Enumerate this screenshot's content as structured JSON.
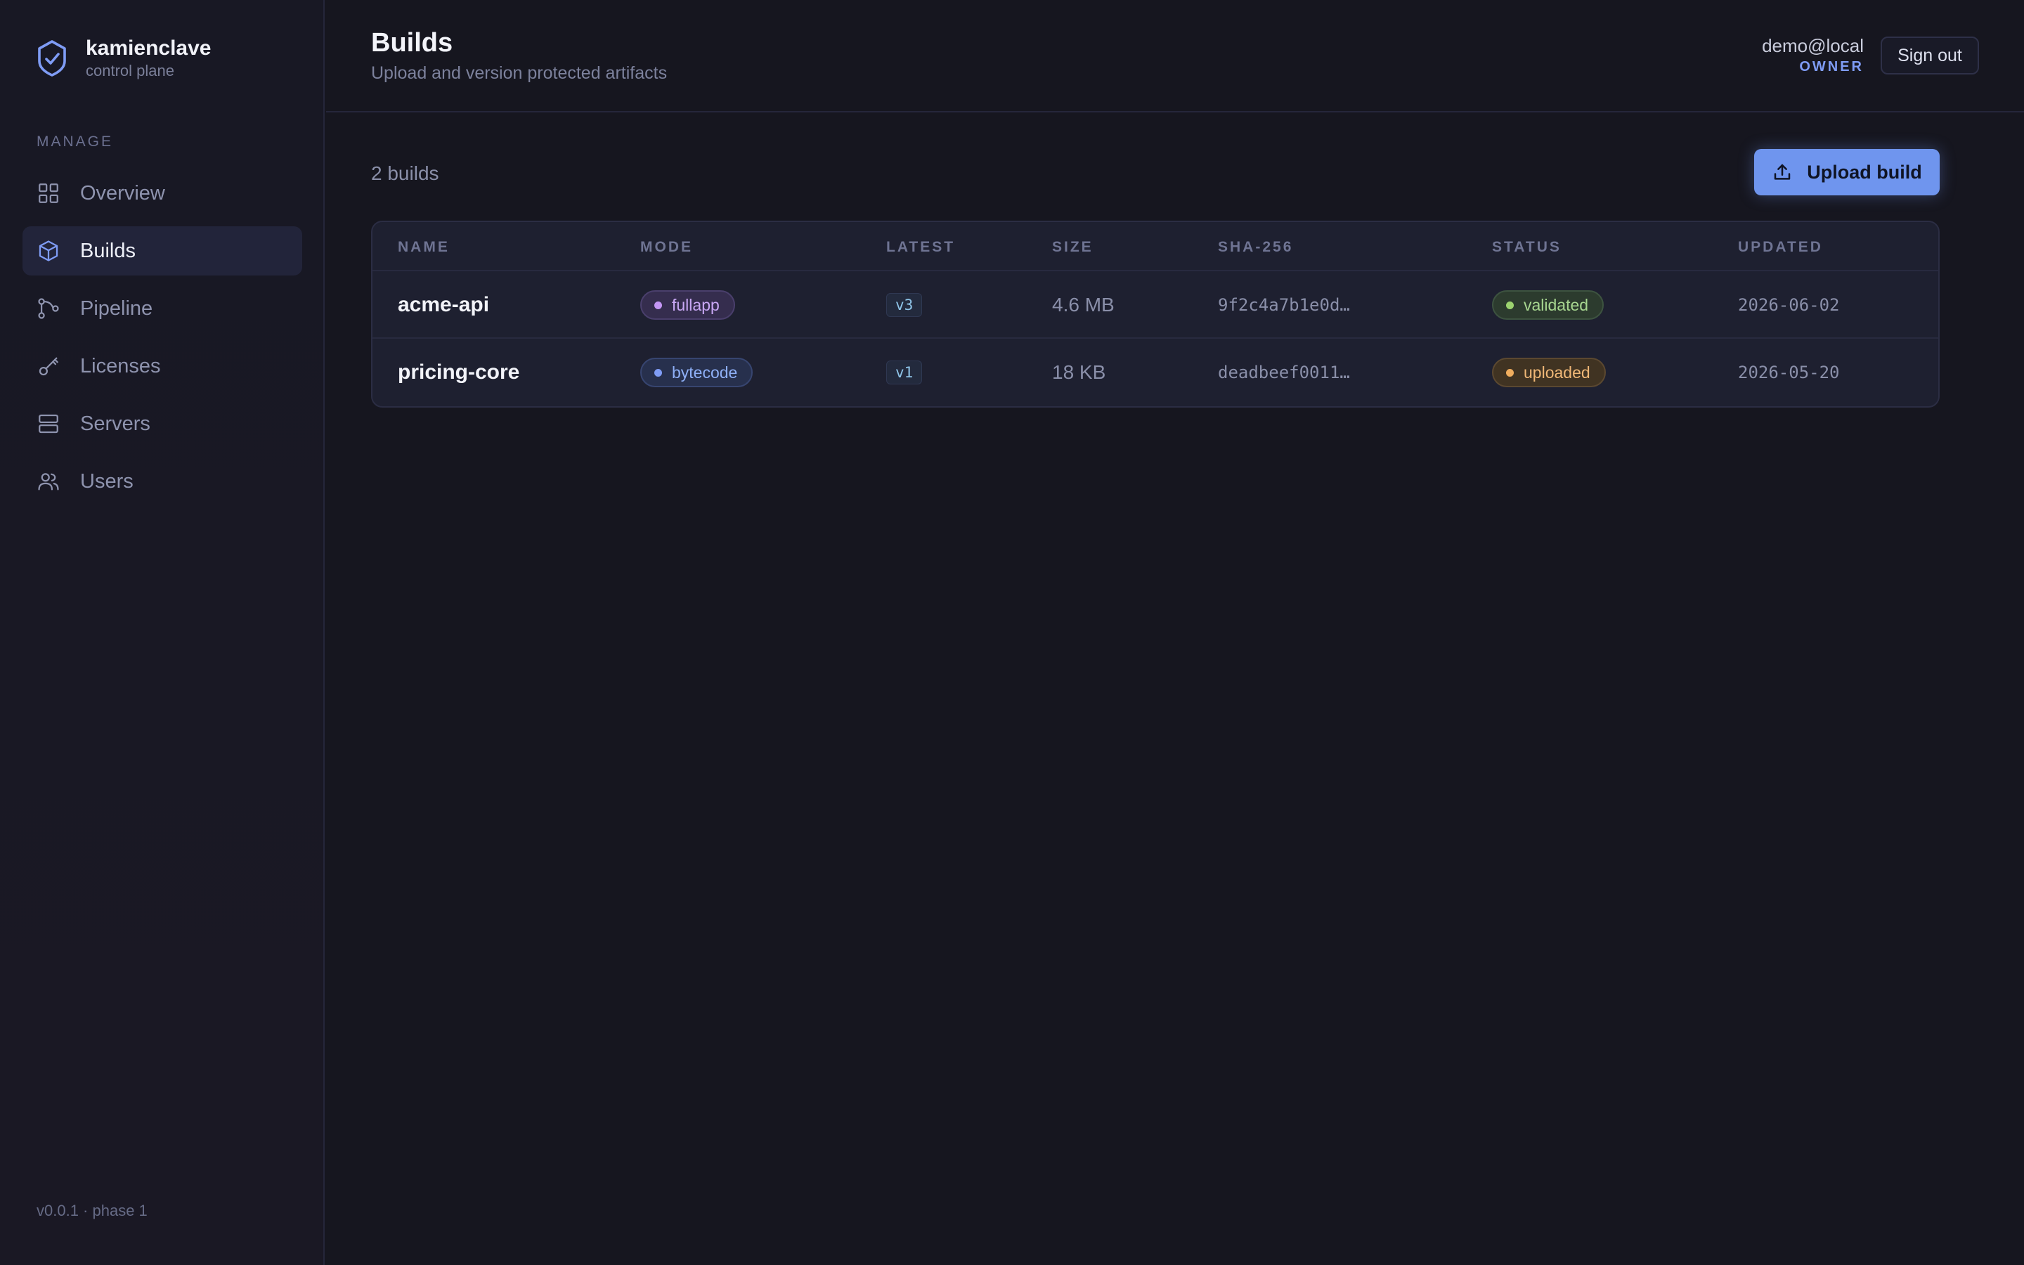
{
  "brand": {
    "name": "kamienclave",
    "subtitle": "control plane"
  },
  "sidebar": {
    "heading": "MANAGE",
    "items": [
      {
        "label": "Overview",
        "icon": "grid-icon",
        "active": false
      },
      {
        "label": "Builds",
        "icon": "cube-icon",
        "active": true
      },
      {
        "label": "Pipeline",
        "icon": "pipeline-icon",
        "active": false
      },
      {
        "label": "Licenses",
        "icon": "key-icon",
        "active": false
      },
      {
        "label": "Servers",
        "icon": "server-icon",
        "active": false
      },
      {
        "label": "Users",
        "icon": "users-icon",
        "active": false
      }
    ],
    "version": "v0.0.1 · phase 1"
  },
  "header": {
    "title": "Builds",
    "subtitle": "Upload and version protected artifacts",
    "user_email": "demo@local",
    "user_role": "OWNER",
    "signout_label": "Sign out"
  },
  "main": {
    "count_label": "2 builds",
    "upload_label": "Upload build",
    "columns": [
      "NAME",
      "MODE",
      "LATEST",
      "SIZE",
      "SHA-256",
      "STATUS",
      "UPDATED"
    ],
    "rows": [
      {
        "name": "acme-api",
        "mode": "fullapp",
        "latest": "v3",
        "size": "4.6 MB",
        "sha": "9f2c4a7b1e0d…",
        "status": "validated",
        "updated": "2026-06-02"
      },
      {
        "name": "pricing-core",
        "mode": "bytecode",
        "latest": "v1",
        "size": "18 KB",
        "sha": "deadbeef0011…",
        "status": "uploaded",
        "updated": "2026-05-20"
      }
    ]
  },
  "colors": {
    "accent": "#6f95ee",
    "background": "#16161f",
    "status_validated": "#9bd26f",
    "status_uploaded": "#f0ad5e",
    "mode_fullapp": "#c496f5",
    "mode_bytecode": "#7f9cf5"
  }
}
